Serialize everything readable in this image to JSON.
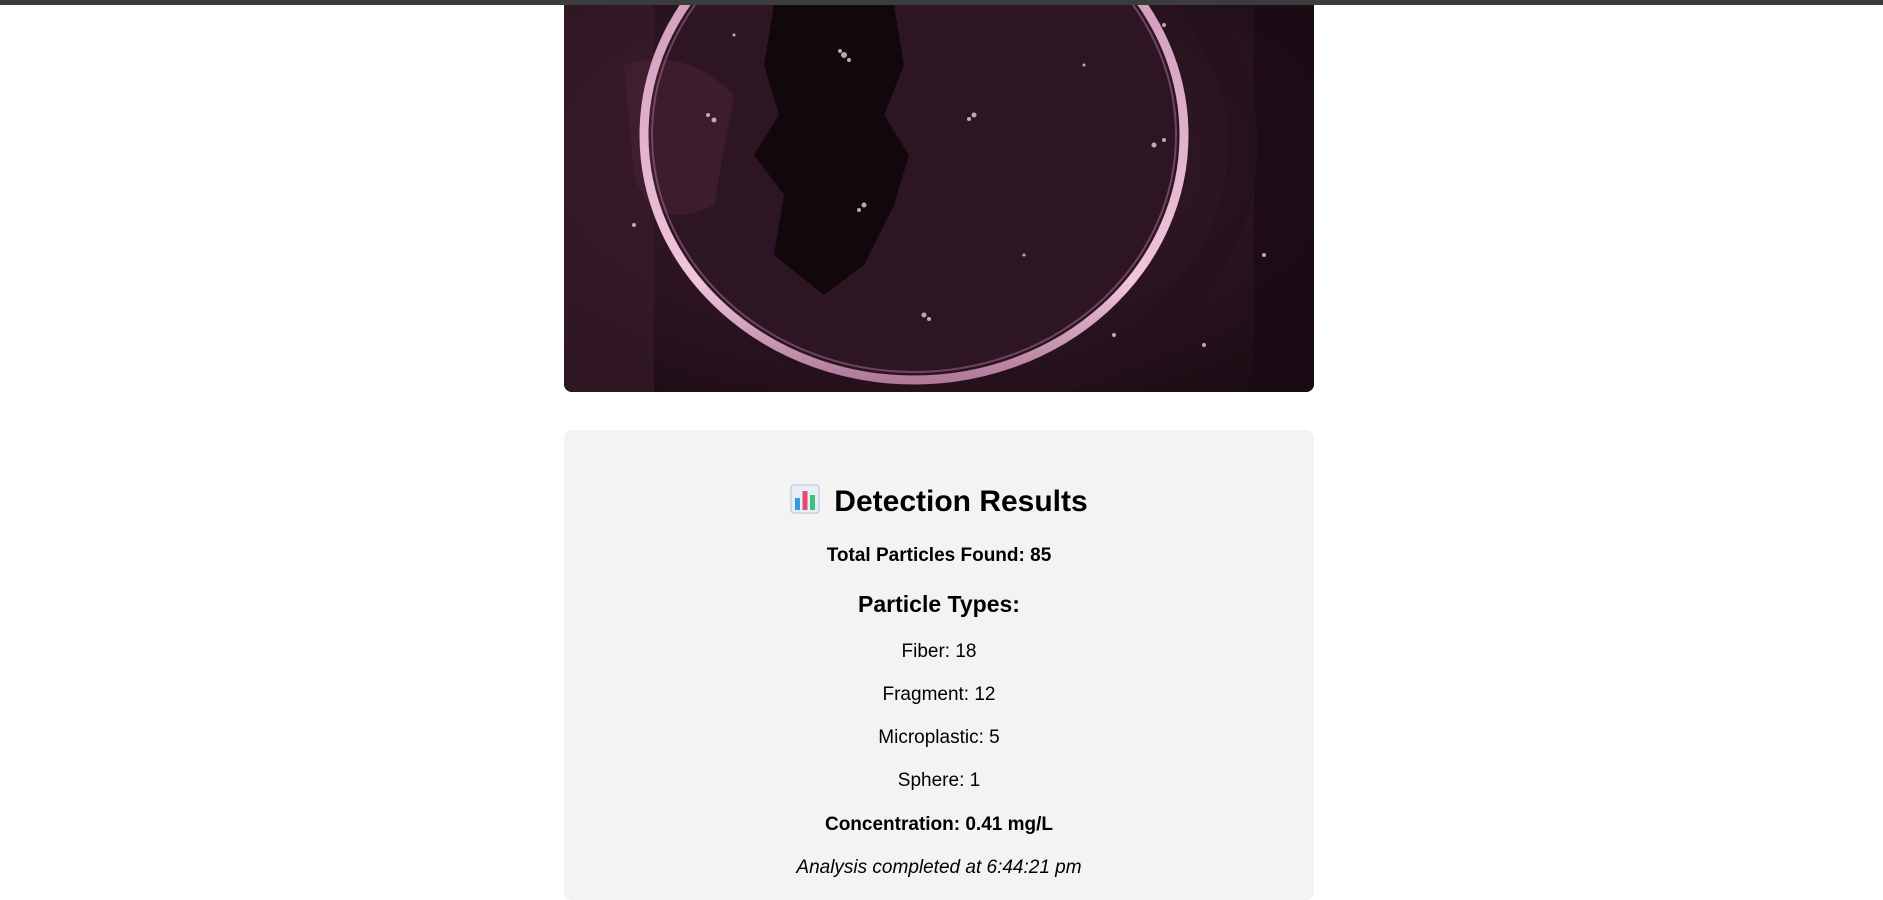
{
  "results": {
    "title": "Detection Results",
    "title_icon": "bar-chart-icon",
    "total_label": "Total Particles Found: 85",
    "types_heading": "Particle Types:",
    "types": [
      {
        "label": "Fiber: 18"
      },
      {
        "label": "Fragment: 12"
      },
      {
        "label": "Microplastic: 5"
      },
      {
        "label": "Sphere: 1"
      }
    ],
    "concentration": "Concentration: 0.41 mg/L",
    "completed": "Analysis completed at 6:44:21 pm"
  },
  "colors": {
    "page_background": "#ffffff",
    "card_background": "#f3f3f3",
    "top_bar": "#3c3c3c",
    "sample_dark": "#2a141d",
    "sample_ring": "#e2b4cf"
  }
}
